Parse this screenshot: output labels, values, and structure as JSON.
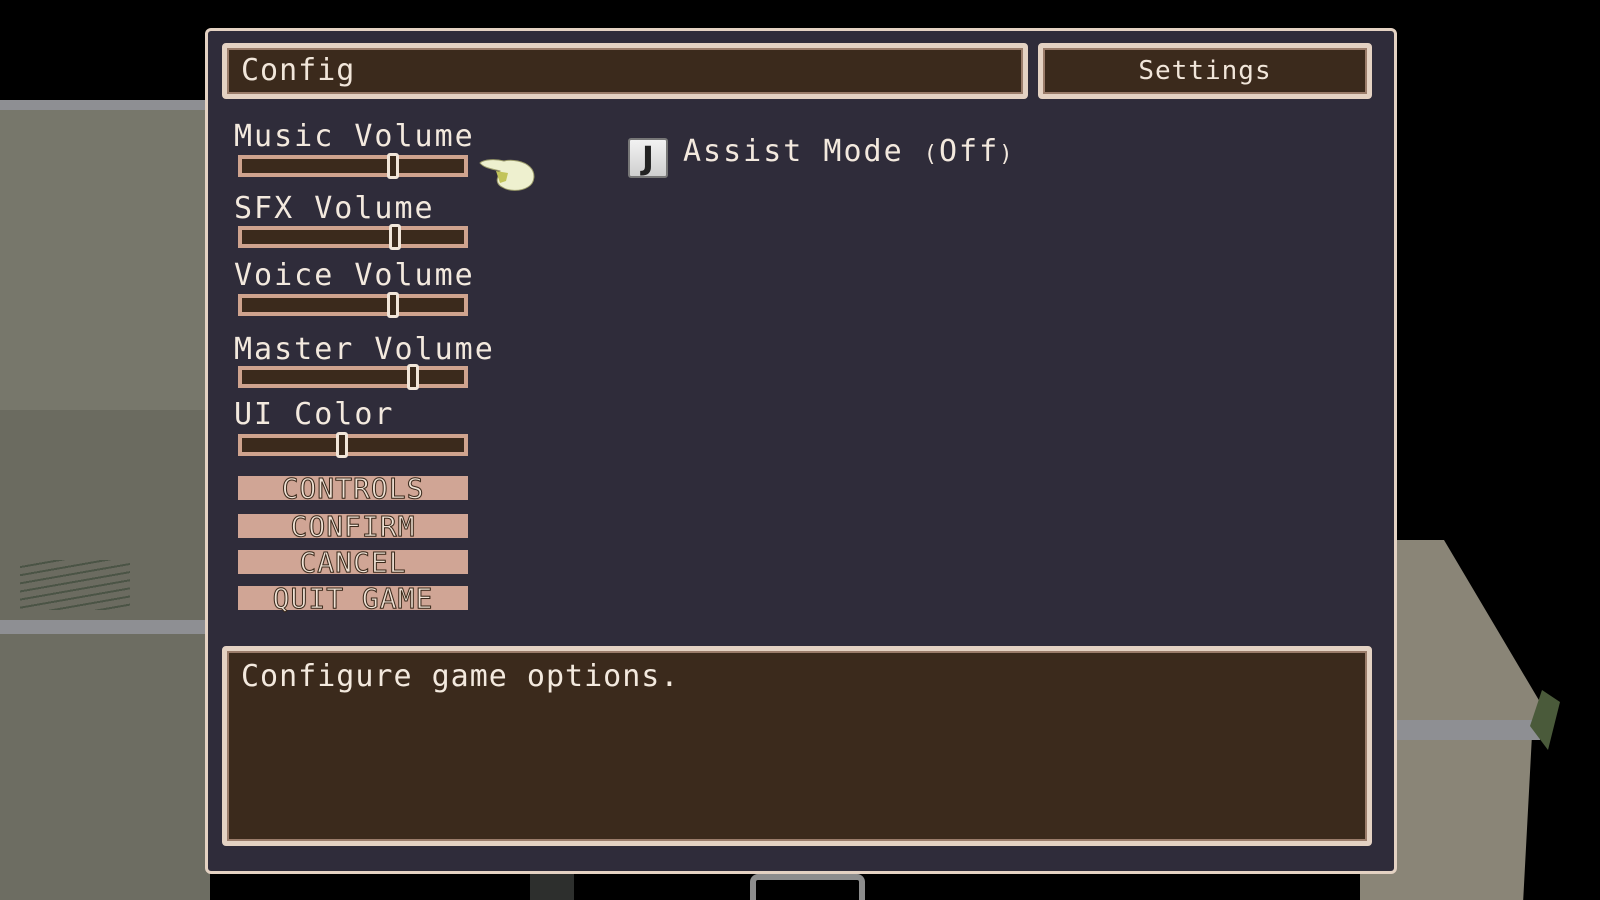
{
  "window": {
    "title": "Config",
    "tab_label": "Settings"
  },
  "sliders": [
    {
      "label": "Music Volume",
      "value_fraction": 0.68
    },
    {
      "label": "SFX Volume",
      "value_fraction": 0.69
    },
    {
      "label": "Voice Volume",
      "value_fraction": 0.68
    },
    {
      "label": "Master Volume",
      "value_fraction": 0.77
    },
    {
      "label": "UI Color",
      "value_fraction": 0.45
    }
  ],
  "menu_buttons": [
    {
      "label": "CONTROLS"
    },
    {
      "label": "CONFIRM"
    },
    {
      "label": "CANCEL"
    },
    {
      "label": "QUIT GAME"
    }
  ],
  "assist_mode": {
    "key_glyph": "J",
    "label": "Assist Mode",
    "state": "Off"
  },
  "description": {
    "text": "Configure game options."
  },
  "cursor": {
    "icon": "pointing-hand-icon",
    "target": "Music Volume"
  },
  "colors": {
    "panel_bg": "#2f2c3a",
    "box_brown": "#3b2a1c",
    "border_cream": "#e4d2c3",
    "button_pink": "#d0a595"
  }
}
